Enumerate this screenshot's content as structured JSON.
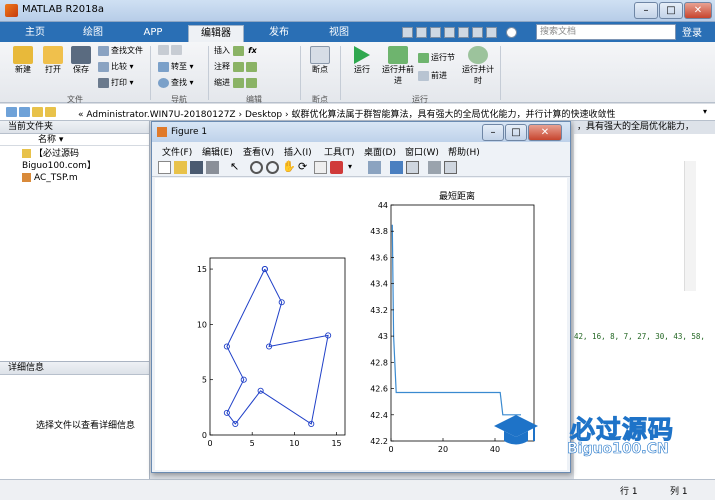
{
  "window": {
    "title": "MATLAB R2018a"
  },
  "tabs": [
    {
      "label": "主页"
    },
    {
      "label": "绘图"
    },
    {
      "label": "APP"
    },
    {
      "label": "编辑器"
    },
    {
      "label": "发布"
    },
    {
      "label": "视图"
    }
  ],
  "search": {
    "placeholder": "搜索文档"
  },
  "login_label": "登录",
  "ribbon": {
    "file": {
      "new": "新建",
      "open": "打开",
      "save": "保存",
      "find_files": "查找文件",
      "compare": "比较",
      "print": "打印",
      "group": "文件"
    },
    "nav": {
      "goto": "转至",
      "find": "查找",
      "group": "导航"
    },
    "edit": {
      "insert": "插入",
      "comment": "注释",
      "indent": "缩进",
      "fx": "fx",
      "group": "编辑"
    },
    "breakpoint": {
      "label": "断点",
      "group": "断点"
    },
    "run": {
      "run": "运行",
      "run_advance": "运行并前进",
      "run_section": "运行节",
      "advance": "前进",
      "run_time": "运行并计时",
      "group": "运行"
    }
  },
  "address": {
    "segments": [
      "«",
      "Administrator.WIN7U-20180127Z",
      "›",
      "Desktop",
      "›",
      "蚁群优化算法属于群智能算法，具有强大的全局优化能力，并行计算的快速收敛性"
    ]
  },
  "left_panel": {
    "title": "当前文件夹",
    "column": "名称",
    "files": [
      {
        "name": "【必过源码 Biguo100.com】"
      },
      {
        "name": "AC_TSP.m"
      }
    ]
  },
  "details": {
    "title": "详细信息",
    "hint": "选择文件以查看详细信息"
  },
  "editor_behind": {
    "title_snip": "，具有强大的全局优化能力，",
    "code_snip": "42, 16, 8, 7, 27, 30, 43, 58,"
  },
  "status": {
    "line_label": "行",
    "line_value": "1",
    "col_label": "列",
    "col_value": "1"
  },
  "figure": {
    "title": "Figure 1",
    "menu": [
      "文件(F)",
      "编辑(E)",
      "查看(V)",
      "插入(I)",
      "工具(T)",
      "桌面(D)",
      "窗口(W)",
      "帮助(H)"
    ]
  },
  "watermark": {
    "text": "必过源码",
    "url": "Biguo100.CN"
  },
  "colors": {
    "tab_bar": "#2a6fb5",
    "route": "#2040c8",
    "line": "#3a8ad0"
  },
  "chart_data": [
    {
      "type": "line",
      "title": "",
      "xlim": [
        0,
        16
      ],
      "ylim": [
        0,
        16
      ],
      "xticks": [
        0,
        5,
        10,
        15
      ],
      "yticks": [
        0,
        5,
        10,
        15
      ],
      "series": [
        {
          "x": [
            6.5,
            8.5,
            7,
            14,
            12,
            6,
            3,
            2,
            4,
            2,
            6.5
          ],
          "y": [
            15,
            12,
            8,
            9,
            1,
            4,
            1,
            2,
            5,
            8,
            15
          ]
        }
      ]
    },
    {
      "type": "line",
      "title": "最短距离",
      "xlim": [
        0,
        55
      ],
      "ylim": [
        42.2,
        44
      ],
      "xticks": [
        0,
        20,
        40
      ],
      "yticks": [
        42.2,
        42.4,
        42.6,
        42.8,
        43,
        43.2,
        43.4,
        43.6,
        43.8,
        44
      ],
      "series": [
        {
          "x": [
            0.5,
            1,
            2,
            42,
            43,
            50
          ],
          "y": [
            43.85,
            43.0,
            42.57,
            42.57,
            42.4,
            42.4
          ]
        }
      ]
    }
  ]
}
